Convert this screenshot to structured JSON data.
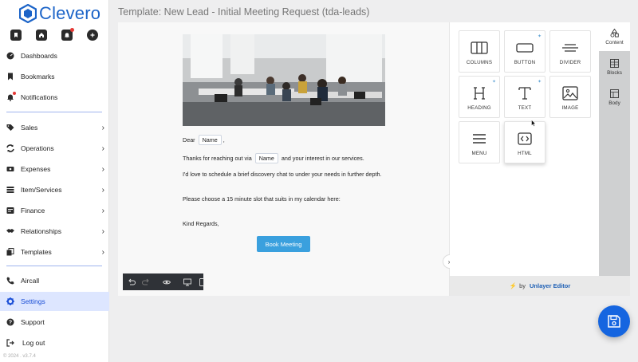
{
  "app": {
    "logo_text": "Clevero",
    "copyright": "© 2024 . v3.7.4"
  },
  "sidebar": {
    "quick_icons": [
      "bookmark-icon",
      "home-icon",
      "bell-icon",
      "plus-icon"
    ],
    "items": [
      {
        "label": "Dashboards",
        "icon": "dashboard-icon"
      },
      {
        "label": "Bookmarks",
        "icon": "bookmark-icon"
      },
      {
        "label": "Notifications",
        "icon": "bell-icon"
      },
      {
        "label": "Sales",
        "icon": "tag-icon"
      },
      {
        "label": "Operations",
        "icon": "sync-icon"
      },
      {
        "label": "Expenses",
        "icon": "money-icon"
      },
      {
        "label": "Item/Services",
        "icon": "list-icon"
      },
      {
        "label": "Finance",
        "icon": "finance-icon"
      },
      {
        "label": "Relationships",
        "icon": "handshake-icon"
      },
      {
        "label": "Templates",
        "icon": "copy-icon"
      },
      {
        "label": "Aircall",
        "icon": "phone-icon"
      },
      {
        "label": "Settings",
        "icon": "gear-icon"
      },
      {
        "label": "Support",
        "icon": "help-icon"
      },
      {
        "label": "Log out",
        "icon": "logout-icon"
      }
    ],
    "active": "Settings",
    "accent_color": "#1b4fd6"
  },
  "page": {
    "title": "Template: New Lead - Initial Meeting Request (tda-leads)"
  },
  "email": {
    "greeting_prefix": "Dear",
    "name_tag": "Name",
    "greeting_suffix": ",",
    "line1_prefix": "Thanks for reaching out via",
    "line1_suffix": "and your interest in our services.",
    "line2": "I'd love to schedule a brief discovery chat to under your needs in further depth.",
    "line3": "Please choose a 15 minute slot that suits in my calendar here:",
    "signoff": "Kind Regards,",
    "button_label": "Book Meeting",
    "button_color": "#3aa0de"
  },
  "toolbar": {
    "icons": [
      "undo-icon",
      "redo-icon",
      "eye-icon",
      "desktop-icon",
      "mobile-icon"
    ]
  },
  "panel": {
    "tiles": [
      {
        "label": "COLUMNS",
        "icon": "columns-icon",
        "ai": false
      },
      {
        "label": "BUTTON",
        "icon": "button-icon",
        "ai": true
      },
      {
        "label": "DIVIDER",
        "icon": "divider-icon",
        "ai": false
      },
      {
        "label": "HEADING",
        "icon": "heading-icon",
        "ai": true
      },
      {
        "label": "TEXT",
        "icon": "text-icon",
        "ai": true
      },
      {
        "label": "IMAGE",
        "icon": "image-icon",
        "ai": false
      },
      {
        "label": "MENU",
        "icon": "menu-icon",
        "ai": false
      },
      {
        "label": "HTML",
        "icon": "html-icon",
        "ai": false
      }
    ],
    "tabs": [
      {
        "label": "Content",
        "icon": "shapes-icon"
      },
      {
        "label": "Blocks",
        "icon": "blocks-icon"
      },
      {
        "label": "Body",
        "icon": "body-icon"
      }
    ],
    "active_tab": "Content",
    "footer_by": "by",
    "footer_brand": "Unlayer Editor"
  }
}
